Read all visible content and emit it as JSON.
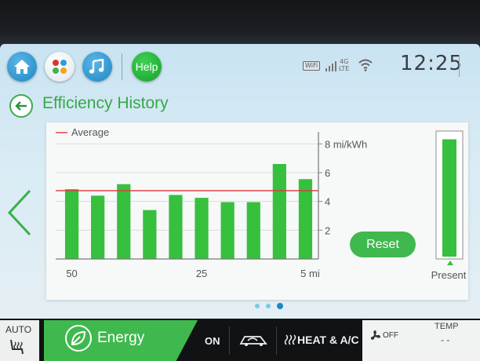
{
  "header": {
    "help_label": "Help",
    "wifi_badge": "WiFi",
    "network_label_top": "4G",
    "network_label_bottom": "LTE",
    "time": "12:25"
  },
  "page": {
    "title": "Efficiency History"
  },
  "chart_data": {
    "type": "bar",
    "legend": "Average",
    "ylabel": "mi/kWh",
    "yticks": [
      2,
      4,
      6,
      8
    ],
    "ylim": [
      0,
      8.4
    ],
    "xtick_labels": [
      "50",
      "25",
      "5 mi"
    ],
    "values": [
      4.85,
      4.4,
      5.2,
      3.4,
      4.45,
      4.25,
      3.95,
      3.95,
      6.6,
      5.55
    ],
    "average": 4.75,
    "present_value": 8.0,
    "present_label": "Present",
    "colors": {
      "bar": "#36c03e",
      "average": "#e0373b"
    }
  },
  "controls": {
    "reset_label": "Reset"
  },
  "pager": {
    "count": 3,
    "active": 2
  },
  "bottom_bar": {
    "auto_label": "AUTO",
    "energy_label": "Energy",
    "on_label": "ON",
    "heat_ac_label": "HEAT & A/C",
    "fan_label": "OFF",
    "temp_label": "TEMP",
    "temp_value": "- -"
  }
}
